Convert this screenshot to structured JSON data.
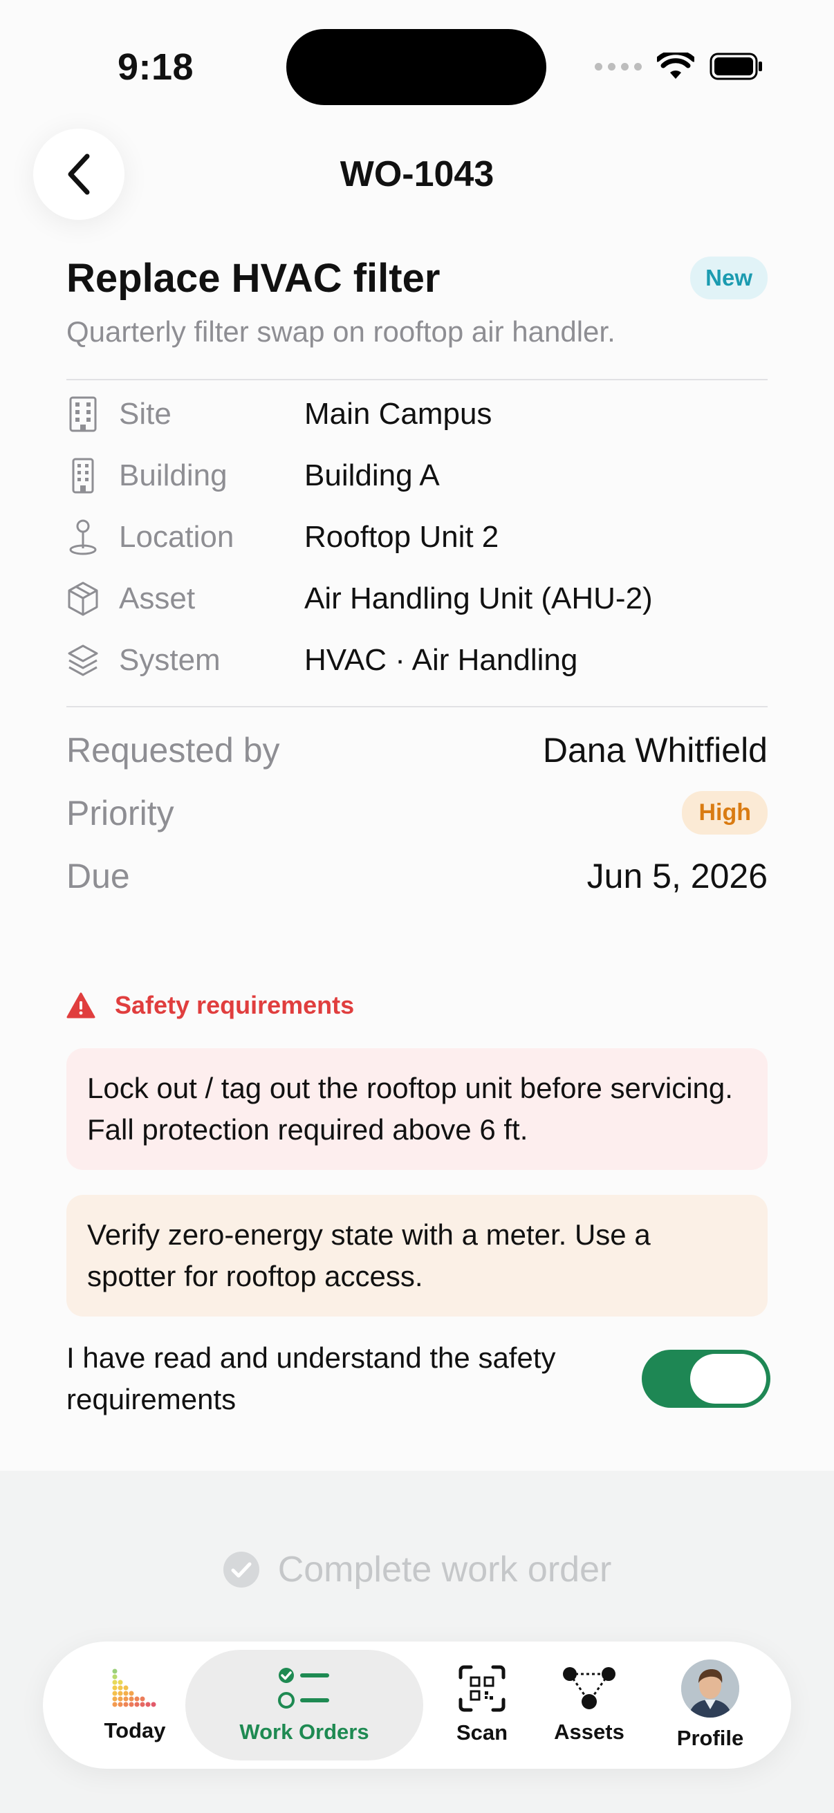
{
  "status_bar": {
    "time": "9:18"
  },
  "header": {
    "title": "WO-1043"
  },
  "work_order": {
    "title": "Replace HVAC filter",
    "status": "New",
    "description": "Quarterly filter swap on rooftop air handler."
  },
  "details": [
    {
      "label": "Site",
      "value": "Main Campus",
      "icon": "building-icon"
    },
    {
      "label": "Building",
      "value": "Building A",
      "icon": "building-narrow-icon"
    },
    {
      "label": "Location",
      "value": "Rooftop Unit 2",
      "icon": "location-pin-icon"
    },
    {
      "label": "Asset",
      "value": "Air Handling Unit (AHU-2)",
      "icon": "box-icon"
    },
    {
      "label": "System",
      "value": "HVAC · Air Handling",
      "icon": "layers-icon"
    }
  ],
  "meta": {
    "requested_by_label": "Requested by",
    "requested_by": "Dana Whitfield",
    "priority_label": "Priority",
    "priority": "High",
    "due_label": "Due",
    "due": "Jun 5, 2026"
  },
  "safety": {
    "heading": "Safety requirements",
    "alerts": [
      "Lock out / tag out the rooftop unit before servicing. Fall protection required above 6 ft.",
      "Verify zero-energy state with a meter. Use a spotter for rooftop access."
    ],
    "ack_text": "I have read and understand the safety requirements",
    "ack_checked": true
  },
  "actions": {
    "complete_label": "Complete work order"
  },
  "tabbar": {
    "tabs": [
      {
        "label": "Today",
        "icon": "chart-dots-icon"
      },
      {
        "label": "Work Orders",
        "icon": "checklist-icon",
        "active": true
      },
      {
        "label": "Scan",
        "icon": "qr-scan-icon"
      },
      {
        "label": "Assets",
        "icon": "network-icon"
      },
      {
        "label": "Profile",
        "icon": "avatar"
      }
    ]
  },
  "colors": {
    "accent_green": "#1e8754",
    "safety_red": "#e03e3e",
    "priority_orange": "#d97b12",
    "status_teal": "#1b9bb0"
  }
}
